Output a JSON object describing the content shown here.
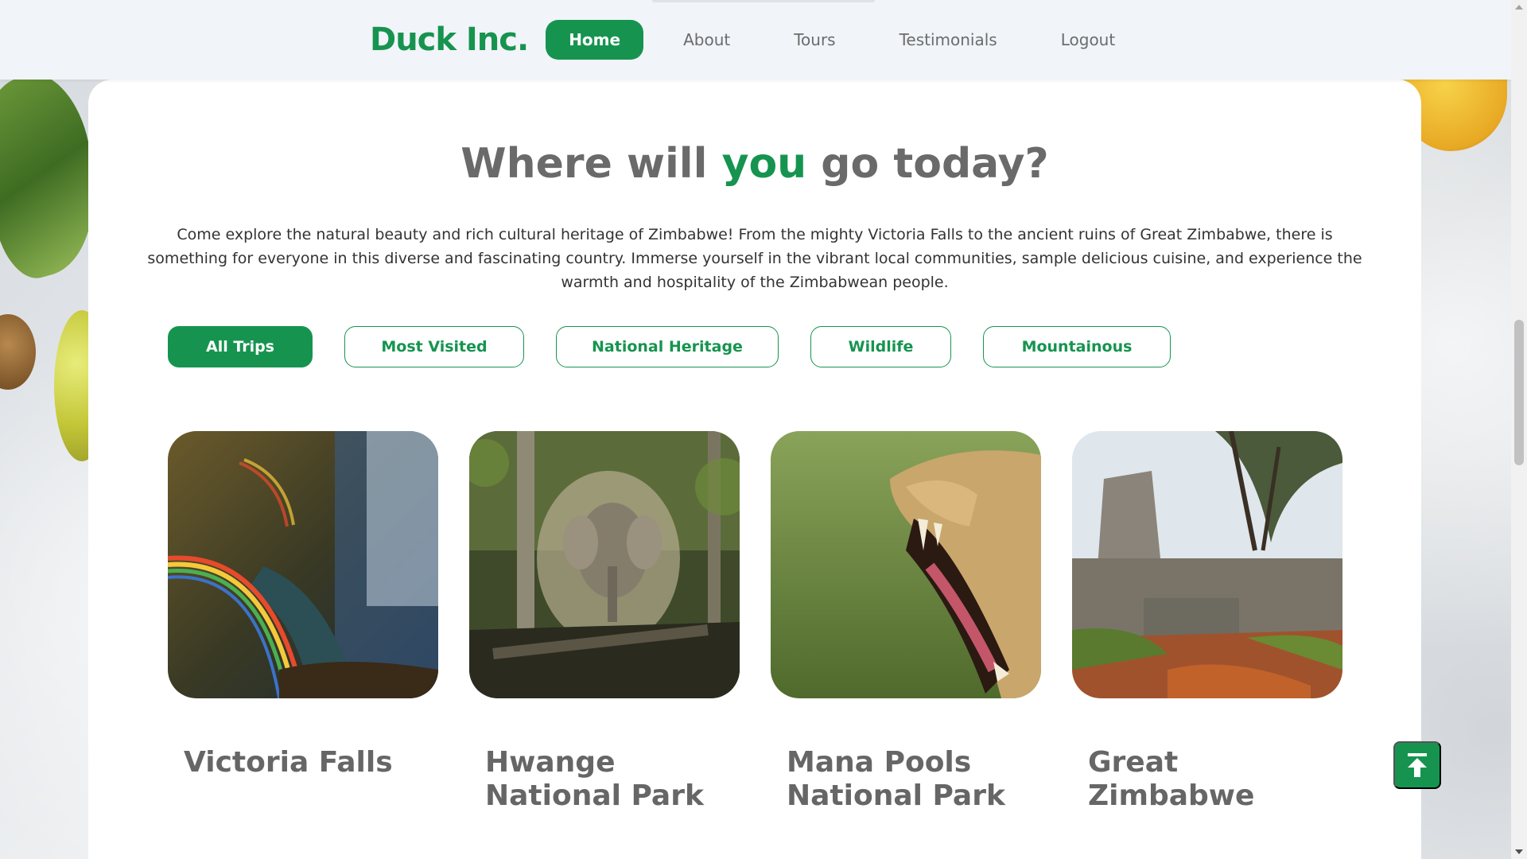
{
  "brand": "Duck Inc.",
  "nav": {
    "home": "Home",
    "about": "About",
    "tours": "Tours",
    "testimonials": "Testimonials",
    "logout": "Logout"
  },
  "hero": {
    "title_before": "Where will ",
    "title_accent": "you",
    "title_after": " go today?",
    "intro": "Come explore the natural beauty and rich cultural heritage of Zimbabwe! From the mighty Victoria Falls to the ancient ruins of Great Zimbabwe, there is something for everyone in this diverse and fascinating country. Immerse yourself in the vibrant local communities, sample delicious cuisine, and experience the warmth and hospitality of the Zimbabwean people."
  },
  "filters": {
    "all": "All Trips",
    "most_visited": "Most Visited",
    "heritage": "National Heritage",
    "wildlife": "Wildlife",
    "mountainous": "Mountainous"
  },
  "tours": [
    {
      "name": "Victoria Falls",
      "image": "victoria-falls-rainbow"
    },
    {
      "name": "Hwange National Park",
      "image": "elephant-in-forest"
    },
    {
      "name": "Mana Pools National Park",
      "image": "lion-yawning"
    },
    {
      "name": "Great Zimbabwe",
      "image": "stone-tower-ruins"
    }
  ],
  "colors": {
    "accent": "#16944f",
    "nav_bg": "#f1f4f8",
    "text_muted": "#6a6a6a"
  },
  "icons": {
    "back_to_top": "arrow-up-to-line-icon"
  }
}
